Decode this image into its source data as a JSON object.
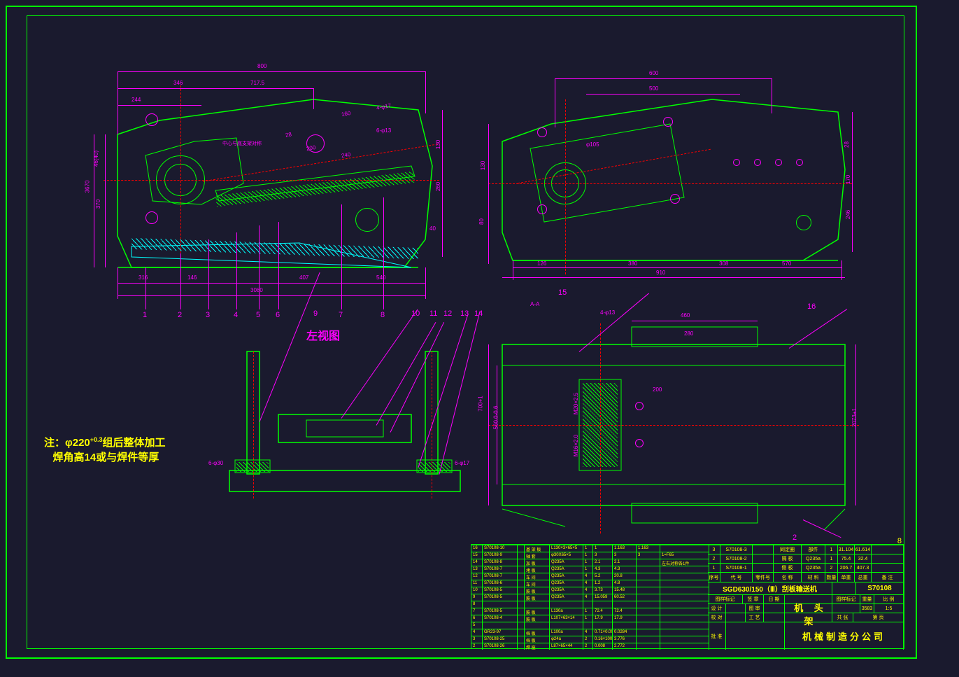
{
  "view_label": "左视图",
  "note_line1_prefix": "注：φ220",
  "note_line1_sup": "+0.3",
  "note_line1_suffix": "组后整体加工",
  "note_line2": "焊角高14或与焊件等厚",
  "callouts": {
    "n1": "1",
    "n2": "2",
    "n3": "3",
    "n4": "4",
    "n5": "5",
    "n6": "6",
    "n7": "7",
    "n8": "8",
    "n9": "9",
    "n10": "10",
    "n11": "11",
    "n12": "12",
    "n13": "13",
    "n14": "14",
    "n15": "15",
    "n16": "16"
  },
  "dims_tl": {
    "d1": "800",
    "d2": "244",
    "d3": "346",
    "d4": "717.5",
    "d5": "46(40)",
    "d6": "160",
    "d7": "370",
    "d8": "3670",
    "d9": "130",
    "d10": "28",
    "d11": "200",
    "d12": "240",
    "d13": "316",
    "d14": "146",
    "d15": "407",
    "d16": "540",
    "d17": "3080",
    "d18": "540",
    "d19": "130",
    "d20": "260",
    "d21": "40",
    "d22": "4-φ17",
    "d23": "6-φ13",
    "d24": "中心与底支架对称"
  },
  "dims_tr": {
    "d1": "600",
    "d2": "500",
    "d3": "910",
    "d4": "130",
    "d5": "80",
    "d6": "28",
    "d7": "170",
    "d8": "246",
    "d9": "126",
    "d10": "380",
    "d11": "308",
    "d12": "570",
    "d13": "φ105"
  },
  "dims_bl": {
    "d1": "6-φ30",
    "d2": "6-φ17"
  },
  "dims_br": {
    "d1": "200",
    "d2": "560.0-0.6",
    "d3": "700+1",
    "d4": "2073+1",
    "d5": "M20×2.5",
    "d6": "M16×2.0",
    "d7": "A-A",
    "d8": "4-φ13",
    "d9": "460",
    "d10": "280",
    "d11": "2"
  },
  "edge_num": "8",
  "bom": [
    {
      "no": "16",
      "code": "S70108-10",
      "name": "基 架 板",
      "spec": "L130×3×65×5",
      "mat": "1",
      "qty": "1",
      "wt1": "1.163",
      "wt2": "1.163",
      "note": ""
    },
    {
      "no": "15",
      "code": "S70108-9",
      "name": "轴 套",
      "spec": "φ30X65×5",
      "mat": "1",
      "qty": "3",
      "wt1": "3",
      "wt2": "3",
      "note": "1=F65"
    },
    {
      "no": "14",
      "code": "S70108-8",
      "name": "加 板",
      "spec": "Q235A",
      "mat": "1",
      "qty": "2.1",
      "wt1": "2.1",
      "wt2": "",
      "note": "左右对称各1件"
    },
    {
      "no": "13",
      "code": "S70108-7",
      "name": "堵 板",
      "spec": "Q235A",
      "mat": "1",
      "qty": "4.3",
      "wt1": "4.3",
      "wt2": "",
      "note": ""
    },
    {
      "no": "12",
      "code": "S70108-7",
      "name": "车 间",
      "spec": "Q235A",
      "mat": "4",
      "qty": "5.2",
      "wt1": "20.8",
      "wt2": "",
      "note": ""
    },
    {
      "no": "11",
      "code": "S70108-6",
      "name": "车 间",
      "spec": "Q235A",
      "mat": "4",
      "qty": "1.2",
      "wt1": "4.8",
      "wt2": "",
      "note": ""
    },
    {
      "no": "10",
      "code": "S70108-5",
      "name": "筋 板",
      "spec": "Q235A",
      "mat": "4",
      "qty": "3.73",
      "wt1": "15.48",
      "wt2": "",
      "note": ""
    },
    {
      "no": "9",
      "code": "S70108-5",
      "name": "筋 板",
      "spec": "Q235A",
      "mat": "4",
      "qty": "15.059",
      "wt1": "60.52",
      "wt2": "",
      "note": ""
    },
    {
      "no": "8",
      "code": "",
      "name": "",
      "spec": "",
      "mat": "",
      "qty": "",
      "wt1": "",
      "wt2": "",
      "note": ""
    },
    {
      "no": "7",
      "code": "S70108-5",
      "name": "筋 板",
      "spec": "L130a",
      "mat": "1",
      "qty": "72.4",
      "wt1": "72.4",
      "wt2": "",
      "note": ""
    },
    {
      "no": "6",
      "code": "S70108-4",
      "name": "筋 板",
      "spec": "L107×63×14",
      "mat": "1",
      "qty": "17.9",
      "wt1": "17.9",
      "wt2": "",
      "note": ""
    },
    {
      "no": "5",
      "code": "",
      "name": "",
      "spec": "",
      "mat": "",
      "qty": "",
      "wt1": "",
      "wt2": "",
      "note": ""
    },
    {
      "no": "4",
      "code": "GR23-97",
      "name": "档 板",
      "spec": "L100a",
      "mat": "4",
      "qty": "0.71×0.001",
      "wt1": "0.0284",
      "wt2": "",
      "note": ""
    },
    {
      "no": "3",
      "code": "S70108-25",
      "name": "档 板",
      "spec": "φ24a",
      "mat": "2",
      "qty": "0.16×100",
      "wt1": "3.776",
      "wt2": "",
      "note": ""
    },
    {
      "no": "2",
      "code": "S70108-26",
      "name": "焊 座",
      "spec": "L87×65×44",
      "mat": "2",
      "qty": "0.008",
      "wt1": "2.772",
      "wt2": "",
      "note": ""
    }
  ],
  "bom_header": {
    "col1": "序号",
    "col2": "代 号",
    "col3": "零件号",
    "col4": "名 称",
    "col5": "材 料",
    "col6": "数量",
    "col7": "单重",
    "col8": "总重",
    "col9": "备 注"
  },
  "tblock_top": [
    {
      "no": "3",
      "code": "S70108-3",
      "name": "同定圈",
      "mat": "部件",
      "qty": "1",
      "wt1": "31.104",
      "wt2": "61.614"
    },
    {
      "no": "2",
      "code": "S70108-2",
      "name": "隔 板",
      "mat": "Q235a",
      "qty": "1",
      "wt1": "75.4",
      "wt2": "32.4"
    },
    {
      "no": "1",
      "code": "S70108-1",
      "name": "侧 板",
      "mat": "Q235a",
      "qty": "2",
      "wt1": "206.7",
      "wt2": "407.3"
    }
  ],
  "title_block": {
    "product": "SGD630/150（Ⅲ）刮板输送机",
    "component": "机 头 架",
    "dwg_no": "S70108",
    "company": "机械制造分公司",
    "fields": {
      "design": "设 计",
      "draft": "图 审",
      "check": "校 对",
      "process": "工 艺",
      "approve": "批 准",
      "date": "日 期",
      "weight": "重量",
      "scale": "比 例",
      "mass": "3583",
      "scl": "1:5",
      "sign": "签 章",
      "sheet": "共  张",
      "page": "第  页",
      "stage": "图样标记"
    }
  }
}
